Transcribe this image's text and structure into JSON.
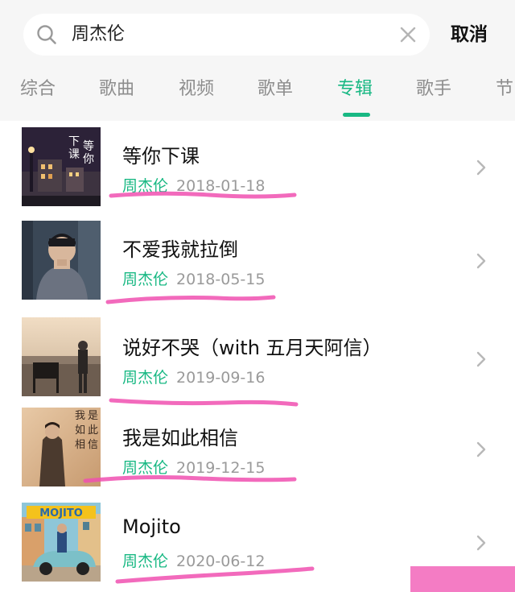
{
  "search": {
    "query": "周杰伦",
    "cancel_label": "取消"
  },
  "tabs": [
    {
      "label": "综合"
    },
    {
      "label": "歌曲"
    },
    {
      "label": "视频"
    },
    {
      "label": "歌单"
    },
    {
      "label": "专辑",
      "active": true
    },
    {
      "label": "歌手"
    },
    {
      "label": "节"
    }
  ],
  "albums": [
    {
      "title": "等你下课",
      "artist": "周杰伦",
      "date": "2018-01-18",
      "cover_text": [
        "下",
        "课",
        "等",
        "你"
      ]
    },
    {
      "title": "不爱我就拉倒",
      "artist": "周杰伦",
      "date": "2018-05-15",
      "cover_text": []
    },
    {
      "title": "说好不哭（with 五月天阿信）",
      "artist": "周杰伦",
      "date": "2019-09-16",
      "cover_text": []
    },
    {
      "title": "我是如此相信",
      "artist": "周杰伦",
      "date": "2019-12-15",
      "cover_text": [
        "我",
        "是",
        "如",
        "此",
        "相",
        "信"
      ]
    },
    {
      "title": "Mojito",
      "artist": "周杰伦",
      "date": "2020-06-12",
      "cover_text": [
        "MOJITO"
      ]
    }
  ],
  "colors": {
    "accent": "#18b883",
    "highlight": "#f050b0"
  }
}
